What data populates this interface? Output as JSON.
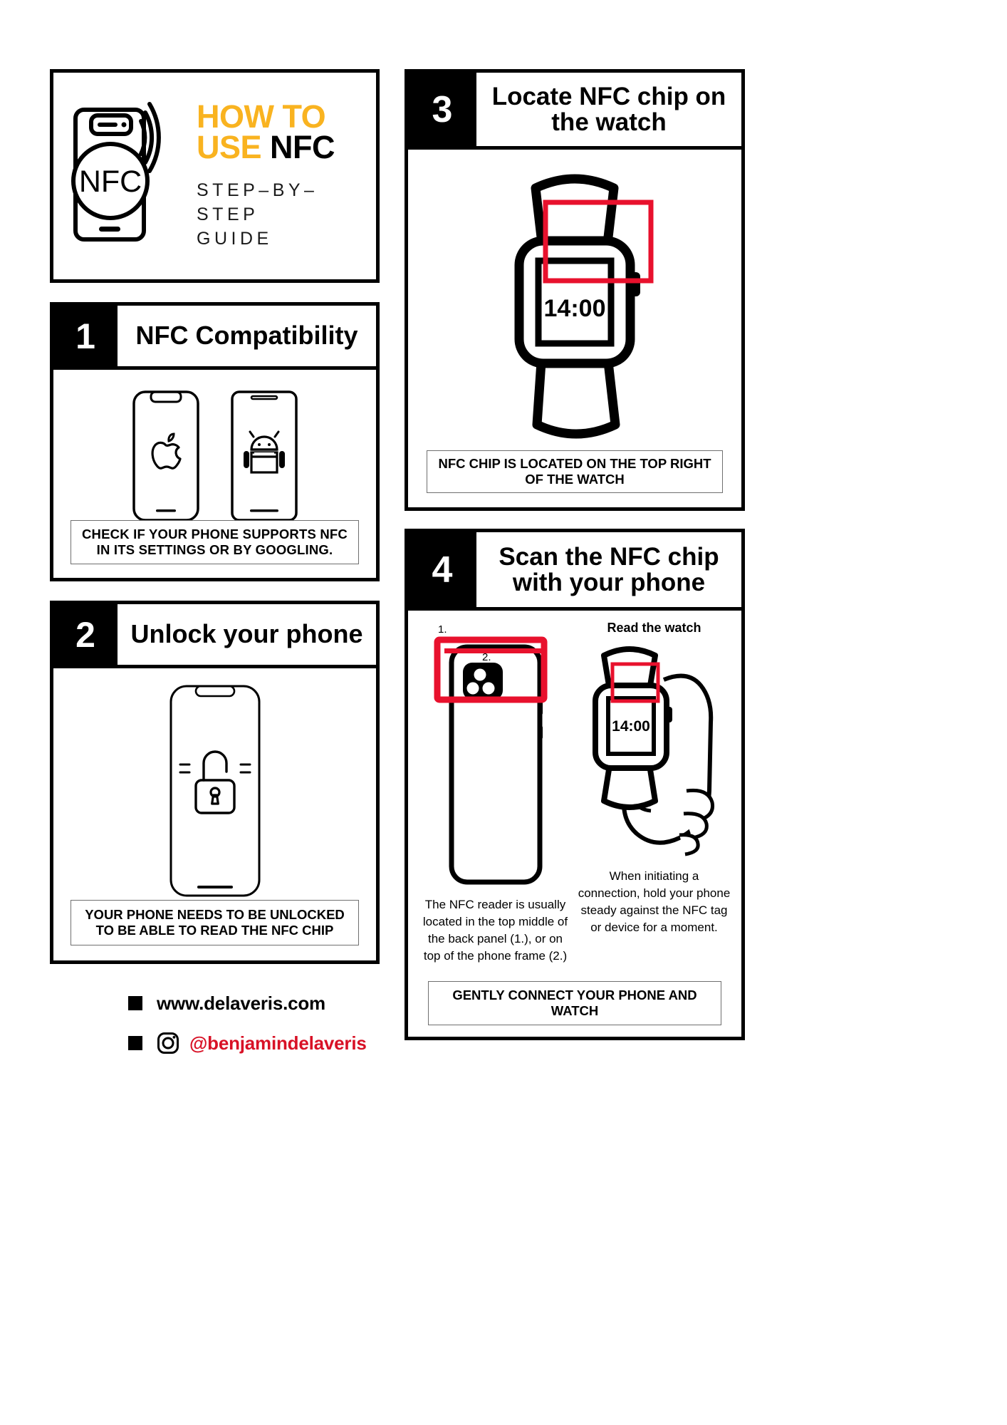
{
  "header": {
    "logo_icon": "nfc-phone-signal-icon",
    "logo_text": "NFC",
    "title_line1_highlight": "HOW TO",
    "title_line2_highlight": "USE",
    "title_line2_rest": " NFC",
    "subtitle_line1": "STEP–BY–STEP",
    "subtitle_line2": "GUIDE",
    "accent_color": "#F9B320"
  },
  "steps": [
    {
      "number": "1",
      "title": "NFC Compatibility",
      "icons": [
        "apple-phone-icon",
        "android-phone-icon"
      ],
      "caption": "CHECK IF YOUR PHONE SUPPORTS NFC IN ITS SETTINGS OR BY GOOGLING."
    },
    {
      "number": "2",
      "title": "Unlock your phone",
      "icons": [
        "unlocked-padlock-phone-icon"
      ],
      "caption": "YOUR PHONE NEEDS TO BE UNLOCKED TO BE ABLE TO READ THE NFC CHIP"
    },
    {
      "number": "3",
      "title": "Locate NFC chip on the watch",
      "watch_time": "14:00",
      "highlight_color": "#E8112D",
      "caption": "NFC CHIP IS LOCATED ON THE TOP RIGHT OF THE WATCH"
    },
    {
      "number": "4",
      "title": "Scan the NFC chip with your phone",
      "marker_1": "1.",
      "marker_2": "2.",
      "right_heading": "Read the watch",
      "watch_time": "14:00",
      "highlight_color": "#E8112D",
      "desc_left": "The NFC reader is usually located in the top middle  of the back panel (1.), or on top of the phone frame (2.)",
      "desc_right": "When initiating a connection, hold your phone steady against the NFC tag or device for a moment.",
      "caption": "GENTLY CONNECT YOUR PHONE AND WATCH"
    }
  ],
  "footer": {
    "website_bullet": "square-bullet-icon",
    "website": "www.delaveris.com",
    "instagram_bullet": "square-bullet-icon",
    "instagram_icon": "instagram-icon",
    "instagram_handle": "@benjamindelaveris",
    "instagram_color": "#D81126"
  }
}
